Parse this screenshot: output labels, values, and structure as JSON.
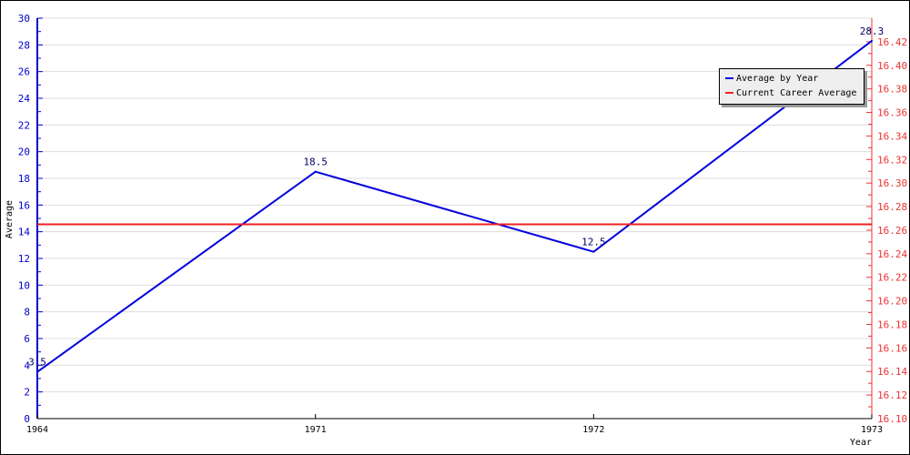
{
  "chart_data": {
    "type": "line",
    "title": "",
    "xlabel": "Year",
    "ylabel": "Average",
    "categories": [
      "1964",
      "1971",
      "1972",
      "1973"
    ],
    "series": [
      {
        "name": "Average by Year",
        "values": [
          3.5,
          18.5,
          12.5,
          28.3
        ],
        "color": "#0000dd",
        "axis": "left",
        "labels": [
          "3.5",
          "18.5",
          "12.5",
          "28.3"
        ]
      },
      {
        "name": "Current Career Average",
        "values": [
          16.265,
          16.265,
          16.265,
          16.265
        ],
        "color": "#ee2222",
        "axis": "right"
      }
    ],
    "y_left": {
      "range": [
        0,
        30
      ],
      "ticks": [
        "0",
        "2",
        "4",
        "6",
        "8",
        "10",
        "12",
        "14",
        "16",
        "18",
        "20",
        "22",
        "24",
        "26",
        "28",
        "30"
      ],
      "color": "#0000cc"
    },
    "y_right": {
      "range": [
        16.1,
        16.44
      ],
      "ticks": [
        "16.10",
        "16.12",
        "16.14",
        "16.16",
        "16.18",
        "16.20",
        "16.22",
        "16.24",
        "16.26",
        "16.28",
        "16.30",
        "16.32",
        "16.34",
        "16.36",
        "16.38",
        "16.40",
        "16.42"
      ],
      "color": "#ee3333"
    },
    "grid": true,
    "legend_position": "top-right"
  },
  "legend": {
    "items": [
      {
        "label": "Average by Year",
        "color": "#0000dd"
      },
      {
        "label": "Current Career Average",
        "color": "#ee2222"
      }
    ]
  }
}
